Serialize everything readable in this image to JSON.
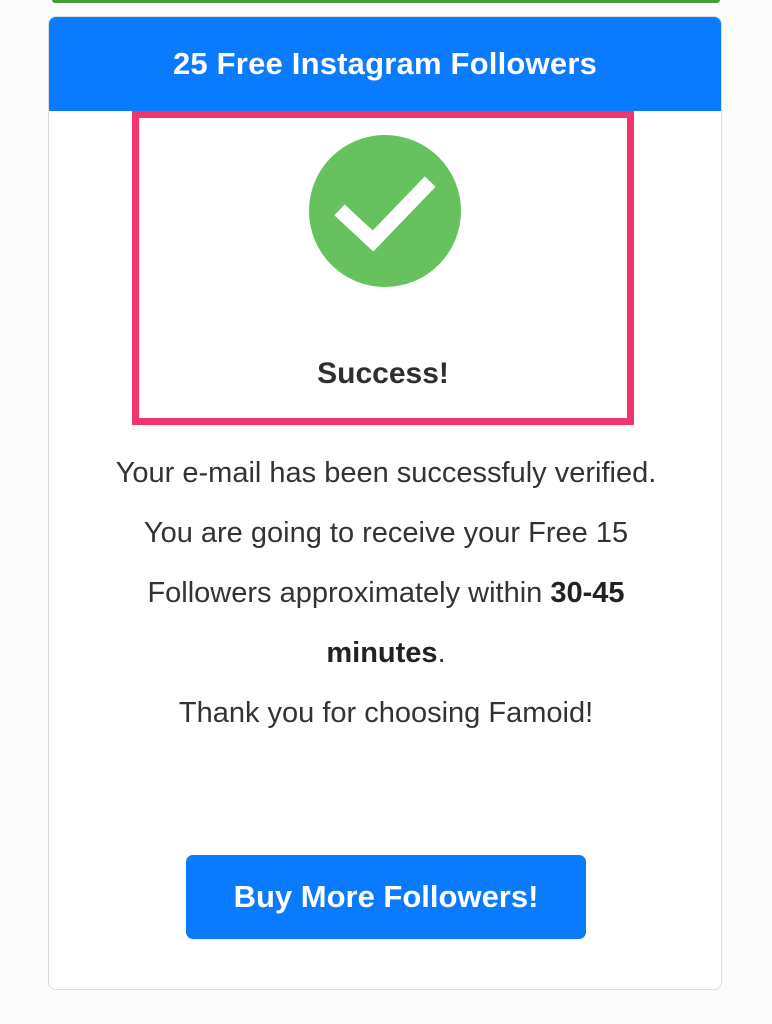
{
  "colors": {
    "header_bg": "#0a7bff",
    "highlight_border": "#f2356e",
    "check_green": "#66c15e",
    "button_bg": "#0a7bff"
  },
  "card": {
    "title": "25 Free Instagram Followers"
  },
  "status": {
    "icon": "check-circle-icon",
    "label": "Success!"
  },
  "message": {
    "line1": "Your e-mail has been successfuly verified.",
    "line2_prefix": "You are going to receive your Free 15 Followers approximately within ",
    "line2_bold1": "30-45",
    "line2_space": " ",
    "line2_bold2": "minutes",
    "line2_suffix": ".",
    "line3": "Thank you for choosing Famoid!"
  },
  "actions": {
    "buy_label": "Buy More Followers!"
  }
}
